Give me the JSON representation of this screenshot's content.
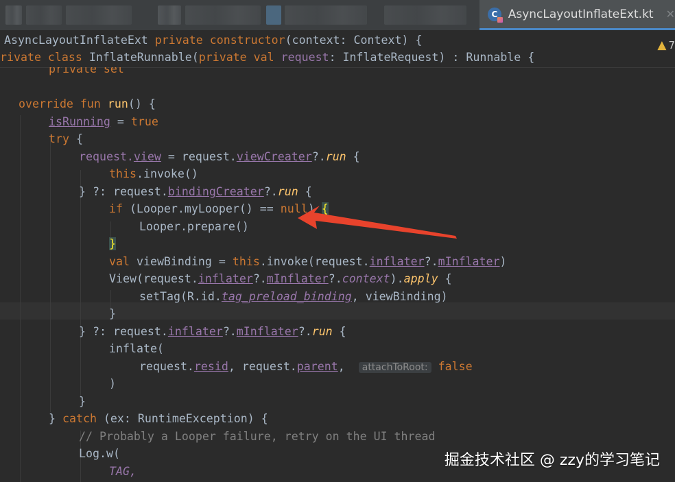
{
  "tabs": {
    "active_title": "AsyncLayoutInflateExt.kt",
    "close_glyph": "✕",
    "kt_icon_letter": "C"
  },
  "header": {
    "line1": {
      "name": "AsyncLayoutInflateExt ",
      "k1": "private constructor",
      "rest": "(context: Context) {"
    },
    "line2": {
      "k1": "rivate class ",
      "name": "InflateRunnable(",
      "k2": "private val ",
      "prop": "request",
      "rest": ": InflateRequest) : Runnable {"
    },
    "warning": {
      "glyph": "▲",
      "count": "7"
    }
  },
  "code": {
    "l0": "private set",
    "l1": {
      "k": "override fun ",
      "f": "run",
      "r": "() {"
    },
    "l2": {
      "p": "isRunning",
      "o": " = ",
      "k": "true"
    },
    "l3": {
      "k": "try",
      "r": " {"
    },
    "l4": {
      "a": "request.",
      "p1": "view",
      "b": " = request.",
      "p2": "viewCreater",
      "c": "?.",
      "f": "run",
      "d": " {"
    },
    "l5": {
      "k": "this",
      "r": ".invoke()"
    },
    "l6": {
      "a": "} ?: request.",
      "p": "bindingCreater",
      "c": "?.",
      "f": "run",
      "d": " {"
    },
    "l7": {
      "k": "if",
      "a": " (Looper.myLooper() == ",
      "n": "null",
      "b": ") ",
      "brace": "{"
    },
    "l8": "Looper.prepare()",
    "l9": "}",
    "l10": {
      "k": "val",
      "a": " viewBinding = ",
      "k2": "this",
      "b": ".invoke(request.",
      "p1": "inflater",
      "c": "?.",
      "p2": "mInflater",
      "d": ")"
    },
    "l11": {
      "a": "View(request.",
      "p1": "inflater",
      "b": "?.",
      "p2": "mInflater",
      "c": "?.",
      "p3": "context",
      "d": ").",
      "f": "apply",
      "e": " {"
    },
    "l12": {
      "a": "setTag(R.id.",
      "p": "tag_preload_binding",
      "b": ", viewBinding)"
    },
    "l13": "}",
    "l14": {
      "a": "} ?: request.",
      "p1": "inflater",
      "b": "?.",
      "p2": "mInflater",
      "c": "?.",
      "f": "run",
      "d": " {"
    },
    "l15": "inflate(",
    "l16": {
      "a": "request.",
      "p1": "resid",
      "b": ", request.",
      "p2": "parent",
      "c": ", ",
      "hint": "attachToRoot:",
      "k": "false"
    },
    "l17": ")",
    "l18": "}",
    "l19": {
      "a": "} ",
      "k": "catch",
      "b": " (ex: RuntimeException) {"
    },
    "l20": "// Probably a Looper failure, retry on the UI thread",
    "l21": "Log.w(",
    "l22": "TAG,"
  },
  "watermark": "掘金技术社区 @ zzy的学习笔记",
  "colors": {
    "background": "#2b2b2b",
    "keyword": "#cc7832",
    "function": "#ffc66d",
    "property": "#9876aa",
    "text": "#a9b7c6",
    "comment": "#808080",
    "arrow": "#e8432c"
  }
}
